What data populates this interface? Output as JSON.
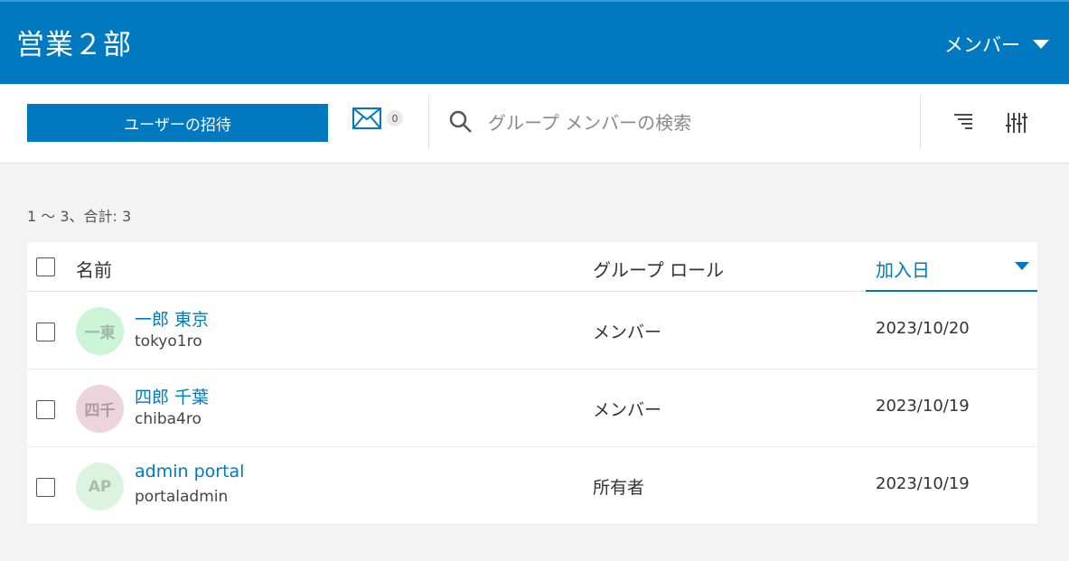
{
  "header": {
    "title": "営業２部",
    "menu_label": "メンバー"
  },
  "toolbar": {
    "invite_label": "ユーザーの招待",
    "mail_count": "0",
    "search_placeholder": "グループ メンバーの検索"
  },
  "results": {
    "count_text": "1 ～ 3、合計: 3"
  },
  "table": {
    "columns": {
      "name": "名前",
      "role": "グループ ロール",
      "joined": "加入日"
    },
    "rows": [
      {
        "initials": "一東",
        "name": "一郎 東京",
        "username": "tokyo1ro",
        "role": "メンバー",
        "joined": "2023/10/20",
        "avatar_bg": "#ccf5d8",
        "avatar_fg": "#9fb8a6"
      },
      {
        "initials": "四千",
        "name": "四郎 千葉",
        "username": "chiba4ro",
        "role": "メンバー",
        "joined": "2023/10/19",
        "avatar_bg": "#edd4dc",
        "avatar_fg": "#b39aa2"
      },
      {
        "initials": "AP",
        "name": "admin portal",
        "username": "portaladmin",
        "role": "所有者",
        "joined": "2023/10/19",
        "avatar_bg": "#dcf4df",
        "avatar_fg": "#a7c0ab"
      }
    ]
  },
  "colors": {
    "brand": "#0079c1"
  }
}
